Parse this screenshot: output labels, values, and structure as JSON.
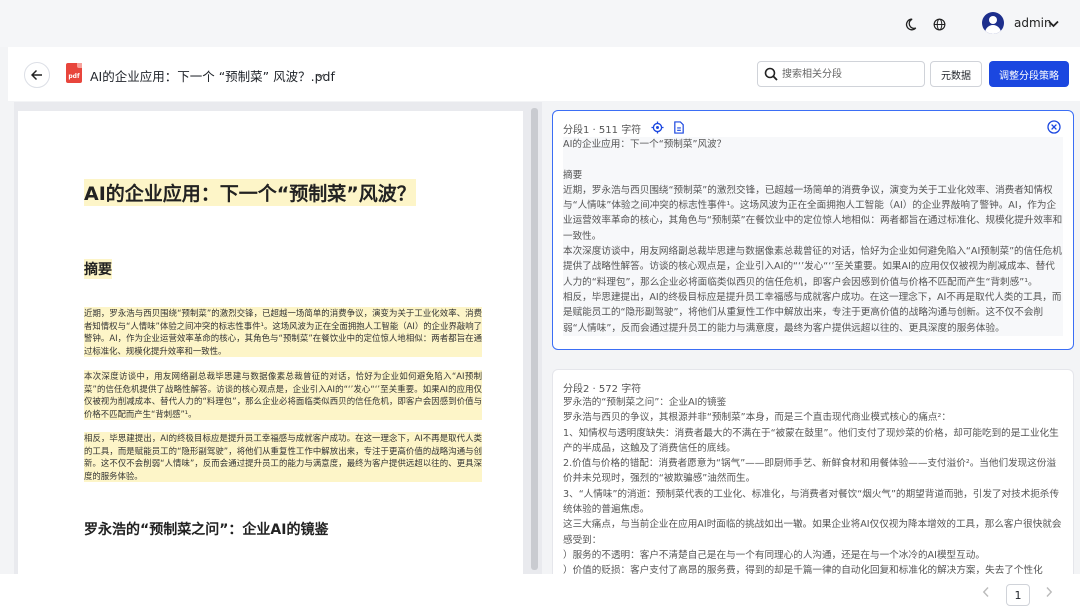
{
  "topbar": {
    "theme_icon": "moon-icon",
    "language_icon": "globe-icon",
    "username": "admin"
  },
  "header": {
    "file_icon_text": "pdf",
    "title": "AI的企业应用：下一个 “预制菜” 风波？.pdf",
    "search_placeholder": "搜索相关分段",
    "metadata_label": "元数据",
    "strategy_label": "调整分段策略"
  },
  "pdf": {
    "h1": "AI的企业应用：下一个“预制菜”风波？",
    "h2": "摘要",
    "p1": "近期，罗永浩与西贝围绕“预制菜”的激烈交锋，已超越一场简单的消费争议，演变为关于工业化效率、消费者知情权与“人情味”体验之间冲突的标志性事件¹。这场风波为正在全面拥抱人工智能（AI）的企业界敲响了警钟。AI，作为企业运营效率革命的核心，其角色与“预制菜”在餐饮业中的定位惊人地相似：两者都旨在通过标准化、规模化提升效率和一致性。",
    "p2": "本次深度访谈中，用友网络副总裁毕思建与数据像素总裁曾征的对话，恰好为企业如何避免陷入“AI预制菜”的信任危机提供了战略性解答。访谈的核心观点是，企业引入AI的“‘’发心“‘’至关重要。如果AI的应用仅仅被视为削减成本、替代人力的“料理包”，那么企业必将面临类似西贝的信任危机，即客户会因感到价值与价格不匹配而产生“背刺感”¹。",
    "p3": "相反，毕思建提出，AI的终极目标应是提升员工幸福感与成就客户成功。在这一理念下，AI不再是取代人类的工具，而是赋能员工的“隐形副驾驶”，将他们从重复性工作中解放出来，专注于更高价值的战略沟通与创新。这不仅不会削弱“人情味”，反而会通过提升员工的能力与满意度，最终为客户提供远超以往的、更具深度的服务体验。",
    "h3": "罗永浩的“预制菜之问”：企业AI的镜鉴"
  },
  "segments": [
    {
      "label": "分段1",
      "chars": "511 字符",
      "lines": [
        "AI的企业应用：下一个“预制菜”风波？",
        "",
        "摘要",
        "近期，罗永浩与西贝围绕“预制菜”的激烈交锋，已超越一场简单的消费争议，演变为关于工业化效率、消费者知情权与“人情味”体验之间冲突的标志性事件¹。这场风波为正在全面拥抱人工智能（AI）的企业界敲响了警钟。AI，作为企业运营效率革命的核心，其角色与“预制菜”在餐饮业中的定位惊人地相似：两者都旨在通过标准化、规模化提升效率和一致性。",
        "本次深度访谈中，用友网络副总裁毕思建与数据像素总裁曾征的对话，恰好为企业如何避免陷入“AI预制菜”的信任危机提供了战略性解答。访谈的核心观点是，企业引入AI的“‘’发心“‘’至关重要。如果AI的应用仅仅被视为削减成本、替代人力的“料理包”，那么企业必将面临类似西贝的信任危机，即客户会因感到价值与价格不匹配而产生“背刺感”¹。",
        "相反，毕思建提出，AI的终极目标应是提升员工幸福感与成就客户成功。在这一理念下，AI不再是取代人类的工具，而是赋能员工的“隐形副驾驶”，将他们从重复性工作中解放出来，专注于更高价值的战略沟通与创新。这不仅不会削弱“人情味”，反而会通过提升员工的能力与满意度，最终为客户提供远超以往的、更具深度的服务体验。"
      ]
    },
    {
      "label": "分段2",
      "chars": "572 字符",
      "lines": [
        "罗永浩的“预制菜之问”：企业AI的镜鉴",
        "罗永浩与西贝的争议，其根源并非“预制菜”本身，而是三个直击现代商业模式核心的痛点²：",
        "1、知情权与透明度缺失：消费者最大的不满在于“被蒙在鼓里”。他们支付了现炒菜的价格，却可能吃到的是工业化生产的半成品，这触及了消费信任的底线。",
        "2.价值与价格的错配：消费者愿意为“锅气”——即厨师手艺、新鲜食材和用餐体验——支付溢价²。当他们发现这份溢价并未兑现时，强烈的“被欺骗感”油然而生。",
        "3、“人情味”的消逝：预制菜代表的工业化、标准化，与消费者对餐饮“烟火气”的期望背道而驰，引发了对技术扼杀传统体验的普遍焦虑。",
        "这三大痛点，与当前企业在应用AI时面临的挑战如出一辙。如果企业将AI仅仅视为降本增效的工具，那么客户很快就会感受到：",
        "）服务的不透明：客户不清楚自己是在与一个有同理心的人沟通，还是在与一个冰冷的AI模型互动。",
        "）价值的贬损：客户支付了高昂的服务费，得到的却是千篇一律的自动化回复和标准化的解决方案，失去了个性化"
      ]
    }
  ],
  "pagination": {
    "current": "1"
  }
}
